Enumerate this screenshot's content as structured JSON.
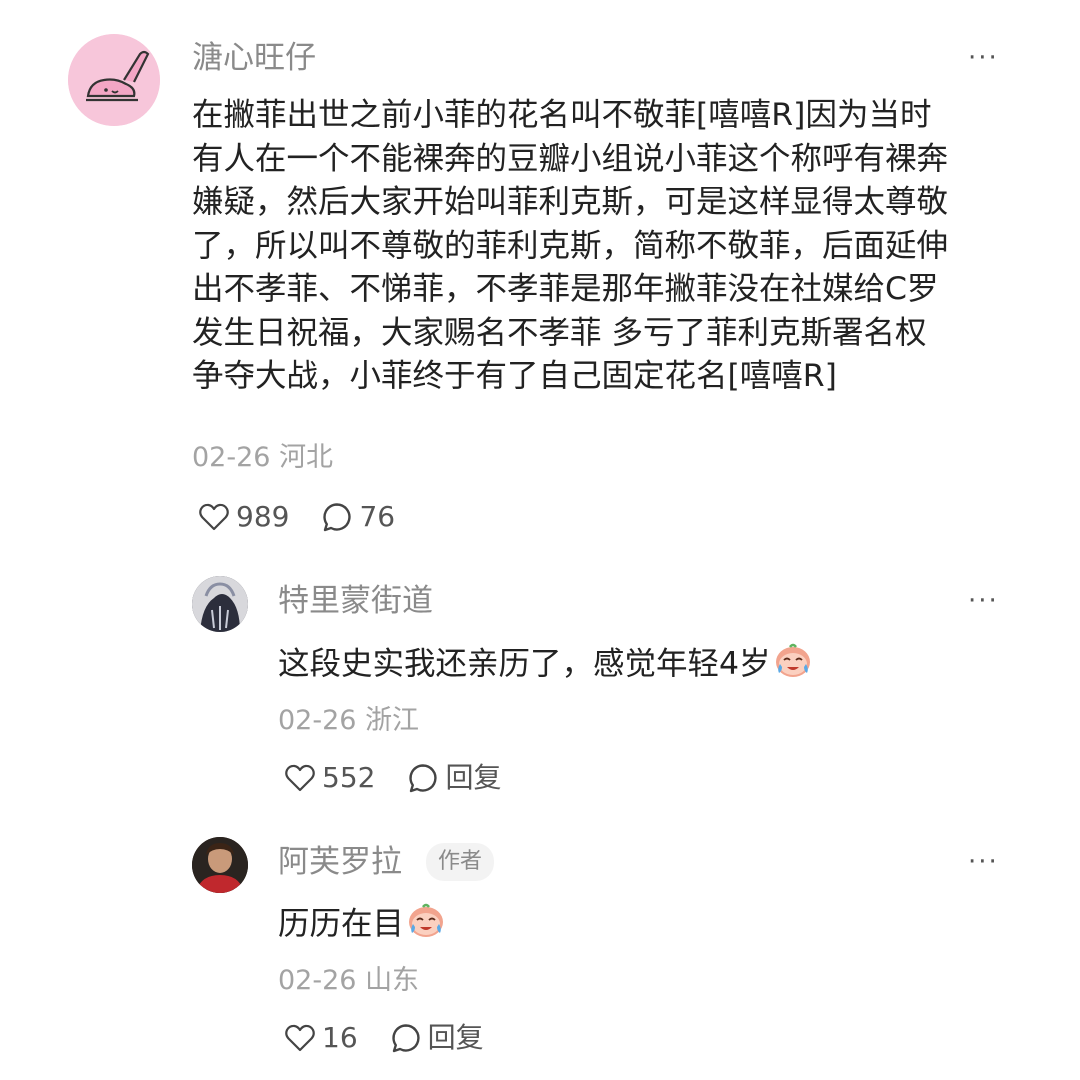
{
  "comment": {
    "username": "溏心旺仔",
    "content_lines": [
      "在撇菲出世之前小菲的花名叫不敬菲[嘻嘻R]因为当时",
      "有人在一个不能裸奔的豆瓣小组说小菲这个称呼有裸奔",
      "嫌疑，然后大家开始叫菲利克斯，可是这样显得太尊敬",
      "了，所以叫不尊敬的菲利克斯，简称不敬菲，后面延伸",
      "出不孝菲、不悌菲，不孝菲是那年撇菲没在社媒给C罗",
      "发生日祝福，大家赐名不孝菲 多亏了菲利克斯署名权",
      "争夺大战，小菲终于有了自己固定花名[嘻嘻R]"
    ],
    "date": "02-26",
    "location": "河北",
    "likes": "989",
    "replies": "76"
  },
  "replies": [
    {
      "username": "特里蒙街道",
      "content": "这段史实我还亲历了，感觉年轻4岁",
      "date": "02-26",
      "location": "浙江",
      "likes": "552",
      "reply_label": "回复"
    },
    {
      "username": "阿芙罗拉",
      "badge": "作者",
      "content": "历历在目",
      "date": "02-26",
      "location": "山东",
      "likes": "16",
      "reply_label": "回复"
    }
  ],
  "more_label": "···",
  "icons": {
    "like": "heart-outline-icon",
    "comment": "speech-bubble-icon",
    "emoji": "crying-laughing-emoji-icon",
    "more": "more-dots-icon"
  }
}
